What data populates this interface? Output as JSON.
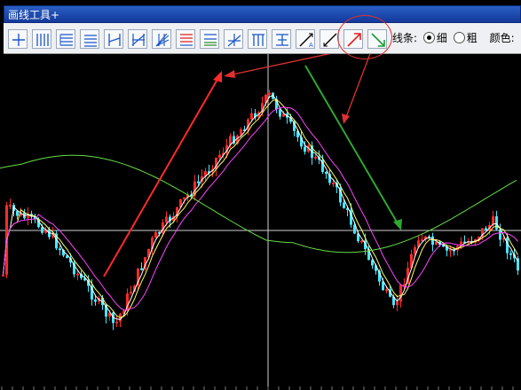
{
  "window": {
    "title": "画线工具+"
  },
  "toolbar": {
    "tools": [
      {
        "name": "horizontal-line-icon"
      },
      {
        "name": "vertical-lines-icon"
      },
      {
        "name": "horizontal-lines-icon"
      },
      {
        "name": "price-channel-icon"
      },
      {
        "name": "period-lines-icon"
      },
      {
        "name": "parallel-channel-icon"
      },
      {
        "name": "fan-lines-icon"
      },
      {
        "name": "fibonacci-icon"
      },
      {
        "name": "percent-lines-icon"
      },
      {
        "name": "gann-lines-icon"
      },
      {
        "name": "fork-lines-icon"
      },
      {
        "name": "resistance-icon"
      },
      {
        "name": "text-arrow-icon"
      },
      {
        "name": "text-marker-icon"
      },
      {
        "name": "up-arrow-icon"
      },
      {
        "name": "down-arrow-icon"
      }
    ],
    "line_label": "线条:",
    "thin_label": "细",
    "thick_label": "粗",
    "selected_weight": "细",
    "color_label": "颜色:"
  },
  "colors": {
    "up_candle": "#ff2a2a",
    "down_candle": "#48e6ff",
    "ma_short": "#ffffff",
    "ma_mid": "#ffff66",
    "ma_long": "#ff44ff",
    "ma_trend": "#66dd44",
    "up_arrow": "#ff2a2a",
    "down_arrow": "#2fa82f",
    "callout": "#e03030",
    "crosshair": "#d0d0d0"
  }
}
